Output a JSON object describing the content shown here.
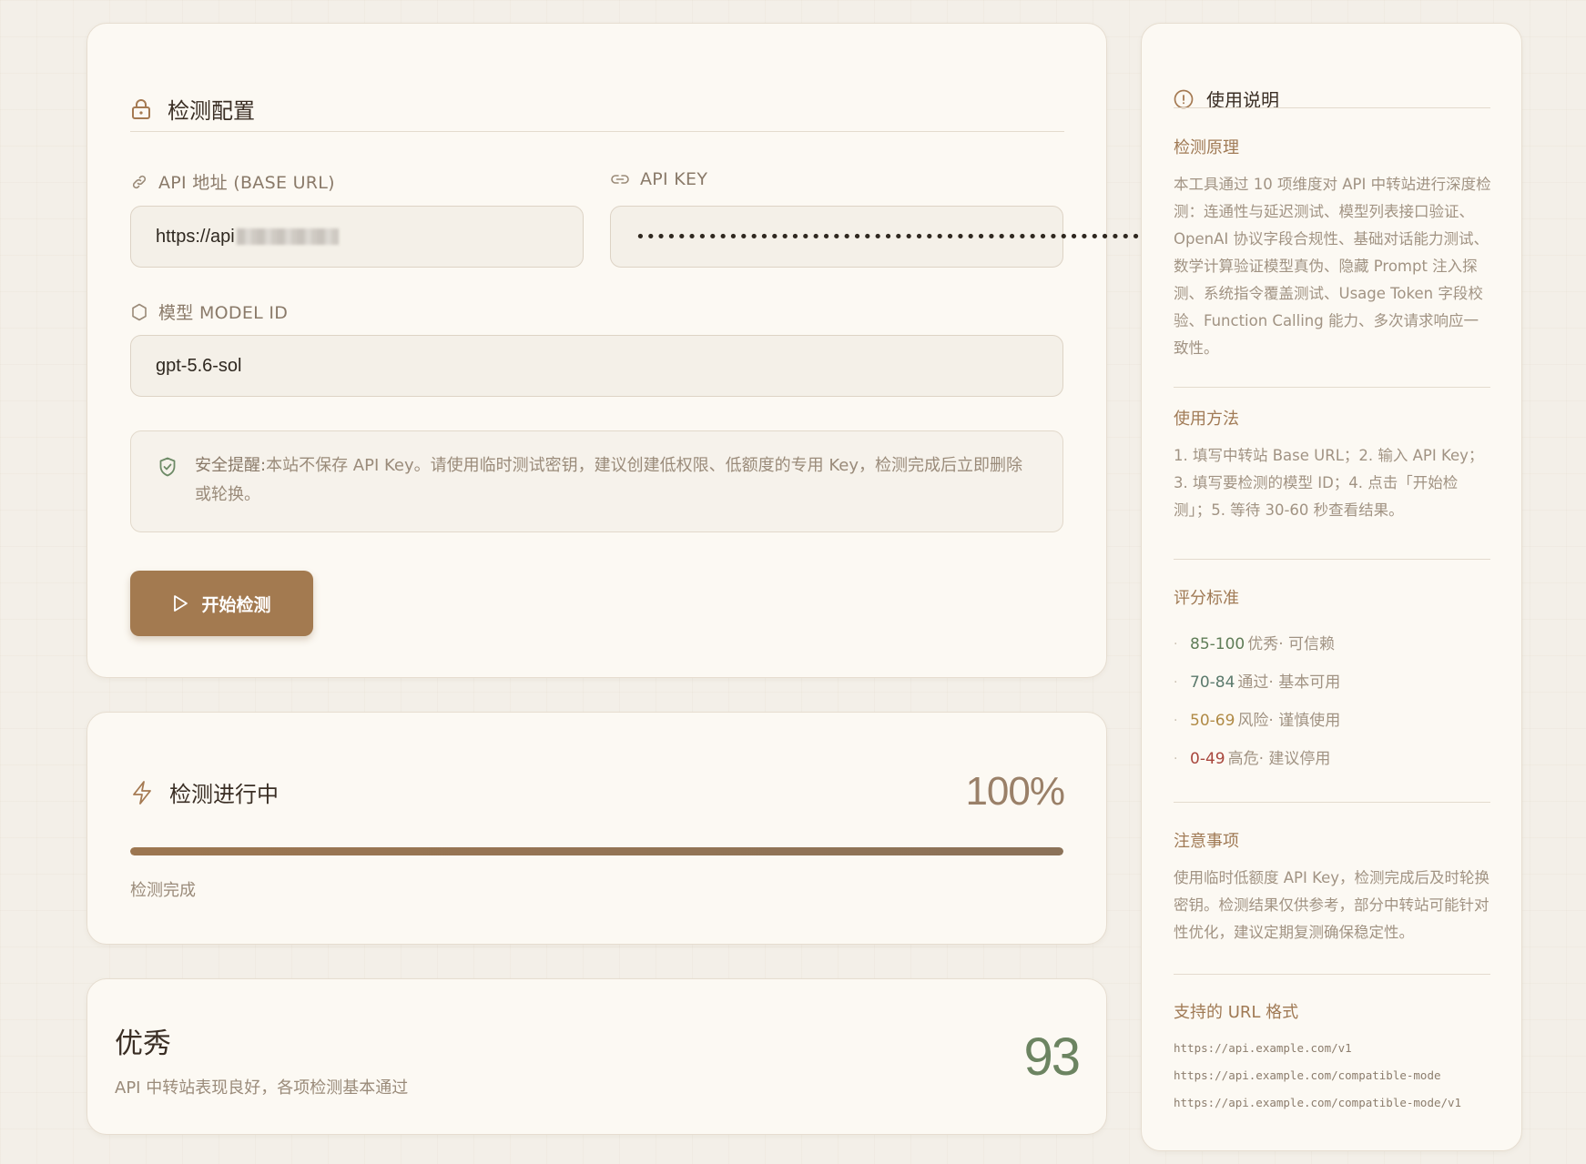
{
  "config": {
    "title": "检测配置",
    "title_icon": "lock-icon",
    "url_label": "API 地址 (BASE URL)",
    "url_icon": "link-icon",
    "url_value": "https://api",
    "key_label": "API KEY",
    "key_icon": "chain-link-icon",
    "key_value": "••••••••••••••••••••••••••••••••••••••••••••••••••••",
    "key_toggle_icon": "eye-icon",
    "model_label": "模型 MODEL ID",
    "model_icon": "hexagon-icon",
    "model_value": "gpt-5.6-sol",
    "notice_icon": "shield-check-icon",
    "notice_prefix": "安全提醒:",
    "notice_text": "本站不保存 API Key。请使用临时测试密钥，建议创建低权限、低额度的专用 Key，检测完成后立即删除或轮换。",
    "start_button": "开始检测",
    "start_icon": "play-icon"
  },
  "progress": {
    "title": "检测进行中",
    "title_icon": "lightning-icon",
    "percent_text": "100%",
    "percent_value": 100,
    "status": "检测完成"
  },
  "result": {
    "grade": "优秀",
    "description": "API 中转站表现良好，各项检测基本通过",
    "score": "93"
  },
  "guide": {
    "title": "使用说明",
    "title_icon": "info-icon",
    "principle_title": "检测原理",
    "principle_text": "本工具通过 10 项维度对 API 中转站进行深度检测：连通性与延迟测试、模型列表接口验证、OpenAI 协议字段合规性、基础对话能力测试、数学计算验证模型真伪、隐藏 Prompt 注入探测、系统指令覆盖测试、Usage Token 字段校验、Function Calling 能力、多次请求响应一致性。",
    "usage_title": "使用方法",
    "usage_text": "1. 填写中转站 Base URL；2. 输入 API Key；3. 填写要检测的模型 ID；4. 点击「开始检测」；5. 等待 30-60 秒查看结果。",
    "scoring_title": "评分标准",
    "scoring": [
      {
        "range": "85-100",
        "grade": "优秀",
        "note": "· 可信赖",
        "color": "#5f7d57"
      },
      {
        "range": "70-84",
        "grade": "通过",
        "note": "· 基本可用",
        "color": "#5b7a6c"
      },
      {
        "range": "50-69",
        "grade": "风险",
        "note": "· 谨慎使用",
        "color": "#b08a45"
      },
      {
        "range": "0-49",
        "grade": "高危",
        "note": "· 建议停用",
        "color": "#a8463c"
      }
    ],
    "notes_title": "注意事项",
    "notes_text": "使用临时低额度 API Key，检测完成后及时轮换密钥。检测结果仅供参考，部分中转站可能针对性优化，建议定期复测确保稳定性。",
    "url_title": "支持的 URL 格式",
    "urls": [
      "https://api.example.com/v1",
      "https://api.example.com/compatible-mode",
      "https://api.example.com/compatible-mode/v1"
    ]
  }
}
